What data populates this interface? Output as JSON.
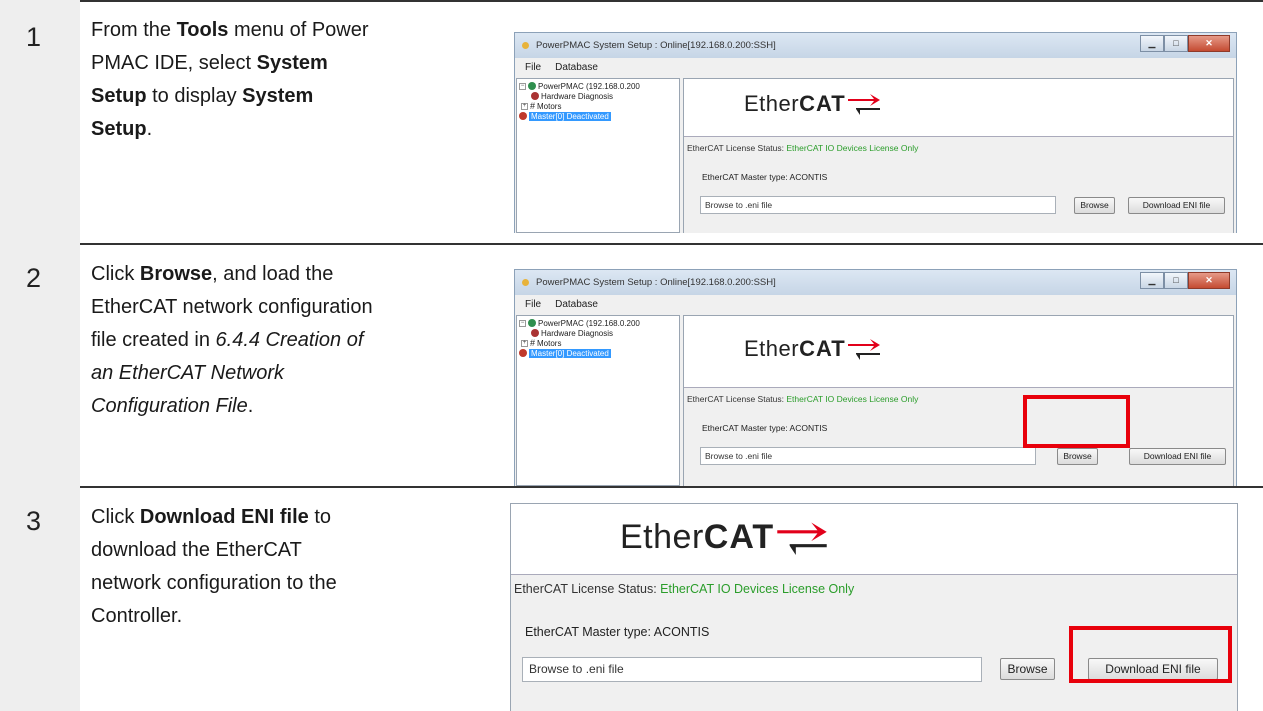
{
  "steps": [
    {
      "number": "1",
      "lines": [
        [
          {
            "t": "From the "
          },
          {
            "t": "Tools",
            "b": true
          },
          {
            "t": " menu of Power"
          }
        ],
        [
          {
            "t": "PMAC IDE, select "
          },
          {
            "t": "System",
            "b": true
          }
        ],
        [
          {
            "t": "Setup",
            "b": true
          },
          {
            "t": " to display "
          },
          {
            "t": "System",
            "b": true
          }
        ],
        [
          {
            "t": "Setup",
            "b": true
          },
          {
            "t": "."
          }
        ]
      ]
    },
    {
      "number": "2",
      "lines": [
        [
          {
            "t": "Click "
          },
          {
            "t": "Browse",
            "b": true
          },
          {
            "t": ", and load the"
          }
        ],
        [
          {
            "t": "EtherCAT network configuration"
          }
        ],
        [
          {
            "t": "file created in "
          },
          {
            "t": "6.4.4 Creation of",
            "i": true
          }
        ],
        [
          {
            "t": "an EtherCAT Network",
            "i": true
          }
        ],
        [
          {
            "t": "Configuration File",
            "i": true
          },
          {
            "t": "."
          }
        ]
      ]
    },
    {
      "number": "3",
      "lines": [
        [
          {
            "t": "Click "
          },
          {
            "t": "Download ENI file",
            "b": true
          },
          {
            "t": " to"
          }
        ],
        [
          {
            "t": "download the EtherCAT"
          }
        ],
        [
          {
            "t": "network configuration to the"
          }
        ],
        [
          {
            "t": "Controller."
          }
        ]
      ]
    }
  ],
  "window": {
    "title": "PowerPMAC System Setup  : Online[192.168.0.200:SSH]",
    "menu": [
      "File",
      "Database"
    ],
    "tree": [
      {
        "label": "PowerPMAC (192.168.0.200",
        "expander": "−",
        "icon": "network"
      },
      {
        "label": "Hardware Diagnosis",
        "icon": "diagnosis"
      },
      {
        "label": "Motors",
        "expander": "+",
        "icon": "motor"
      },
      {
        "label": "Master[0] Deactivated",
        "icon": "master",
        "selected": true
      }
    ]
  },
  "ethercat": {
    "logo_text_ether": "Ether",
    "logo_text_cat": "CAT",
    "license_label": "EtherCAT License Status:",
    "license_status": "EtherCAT IO Devices License Only",
    "master_type": "EtherCAT Master type:  ACONTIS",
    "eni_path": "Browse to .eni file",
    "browse_button": "Browse",
    "download_button": "Download ENI file"
  },
  "colors": {
    "highlight": "#e8000b",
    "license_status": "#2a9d2a"
  }
}
